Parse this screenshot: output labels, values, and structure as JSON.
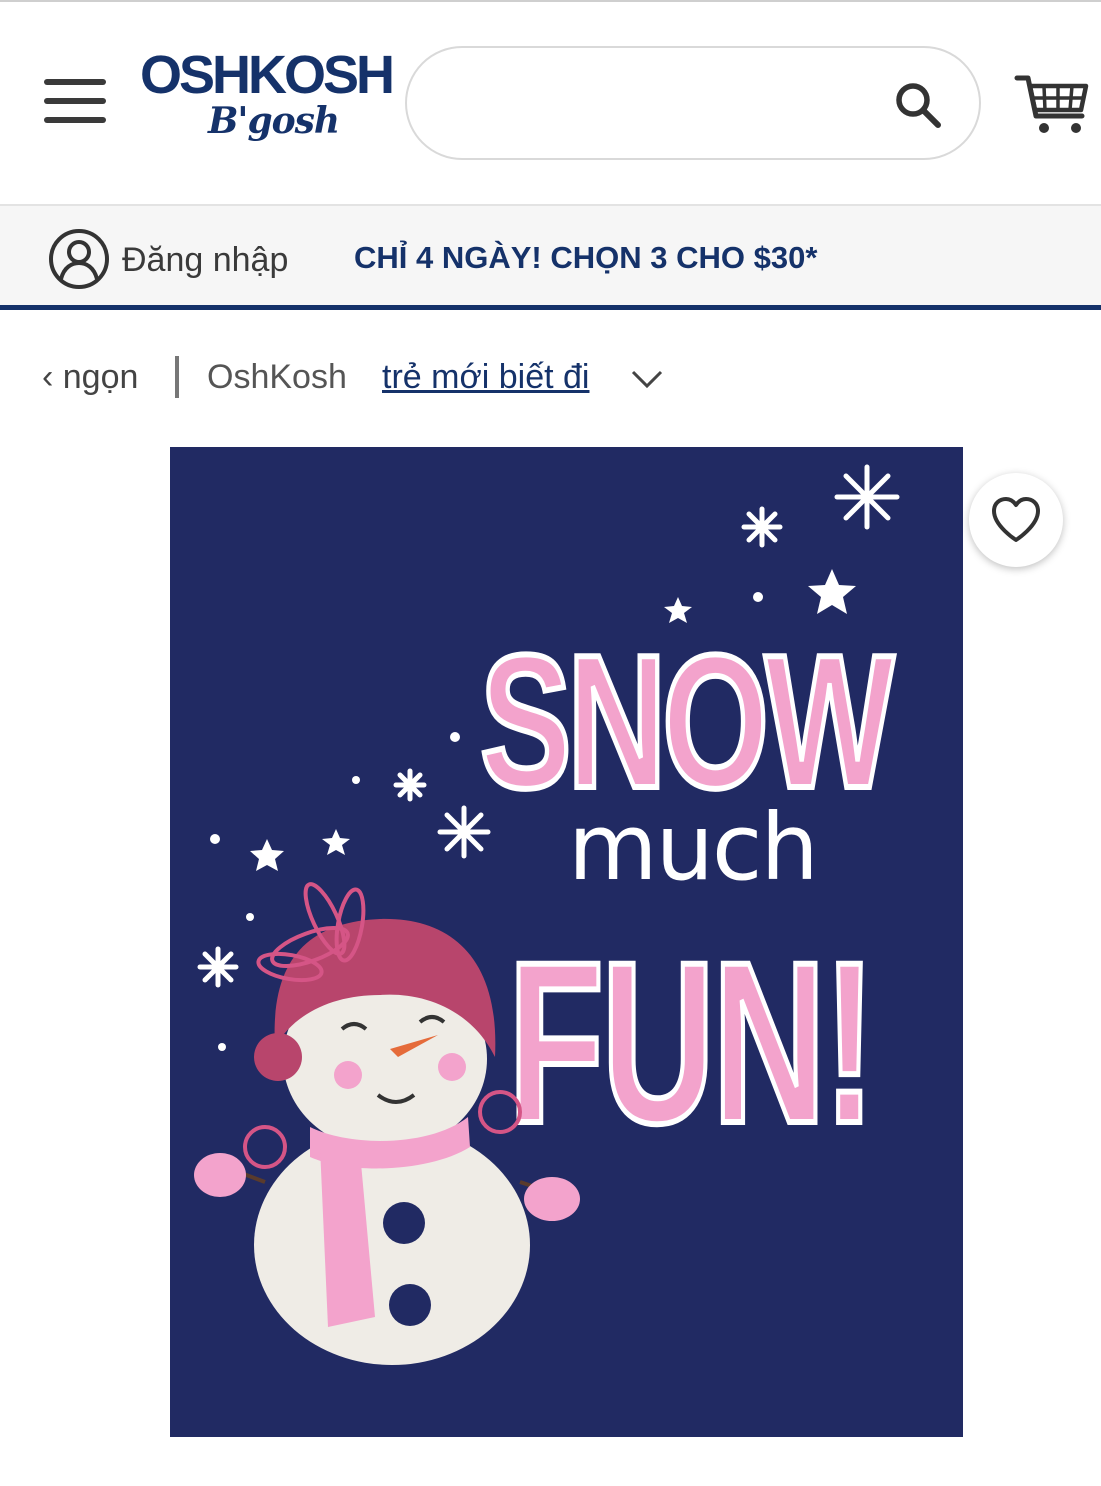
{
  "header": {
    "menu_icon": "hamburger-menu-icon",
    "logo": {
      "line1": "OSHKOSH",
      "line2": "B'gosh"
    },
    "search": {
      "value": "",
      "placeholder": "",
      "icon": "search-icon"
    },
    "cart_icon": "cart-icon"
  },
  "promo_bar": {
    "login_icon": "user-icon",
    "login_label": "Đăng nhập",
    "promo_text": "CHỈ 4 NGÀY! CHỌN 3 CHO $30*"
  },
  "breadcrumb": {
    "back_label": "‹ ngọn",
    "brand": "OshKosh",
    "current": "trẻ mới biết đi"
  },
  "product": {
    "image_text": {
      "line1": "SNOW",
      "line2": "much",
      "line3": "FUN!"
    },
    "background_color": "#212a63",
    "favorite_icon": "heart-icon"
  },
  "colors": {
    "brand_navy": "#15326a",
    "print_pink": "#f3a3cc"
  }
}
